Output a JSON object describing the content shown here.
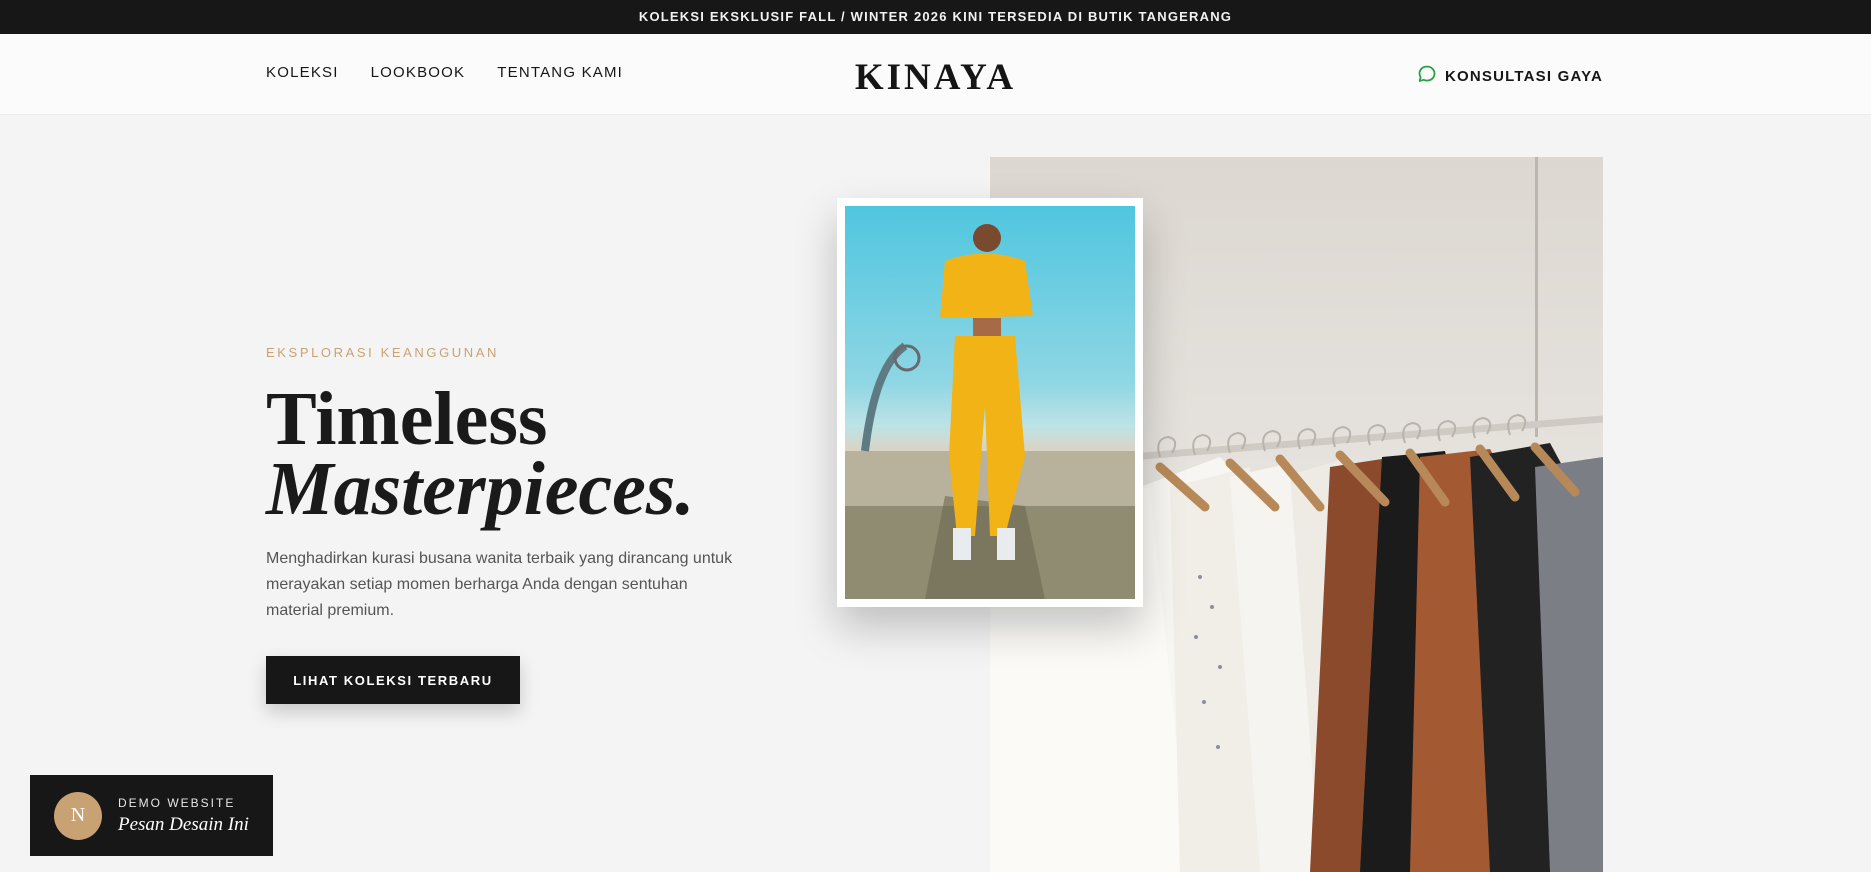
{
  "announcement": "KOLEKSI EKSKLUSIF FALL / WINTER 2026 KINI TERSEDIA DI BUTIK TANGERANG",
  "nav": {
    "links": [
      "KOLEKSI",
      "LOOKBOOK",
      "TENTANG KAMI"
    ],
    "logo": "KINAYA",
    "consult_label": "KONSULTASI GAYA",
    "consult_icon": "chat-bubble-icon",
    "consult_icon_color": "#25a244"
  },
  "hero": {
    "eyebrow": "EKSPLORASI KEANGGUNAN",
    "headline_line1": "Timeless",
    "headline_line2": "Masterpieces.",
    "description": "Menghadirkan kurasi busana wanita terbaik yang dirancang untuk merayakan setiap momen berharga Anda dengan sentuhan material premium.",
    "cta_label": "LIHAT KOLEKSI TERBARU"
  },
  "demo_badge": {
    "avatar_letter": "N",
    "label": "DEMO WEBSITE",
    "cta": "Pesan Desain Ini"
  },
  "colors": {
    "accent": "#c9a274",
    "dark": "#171717",
    "background": "#f4f4f4"
  }
}
